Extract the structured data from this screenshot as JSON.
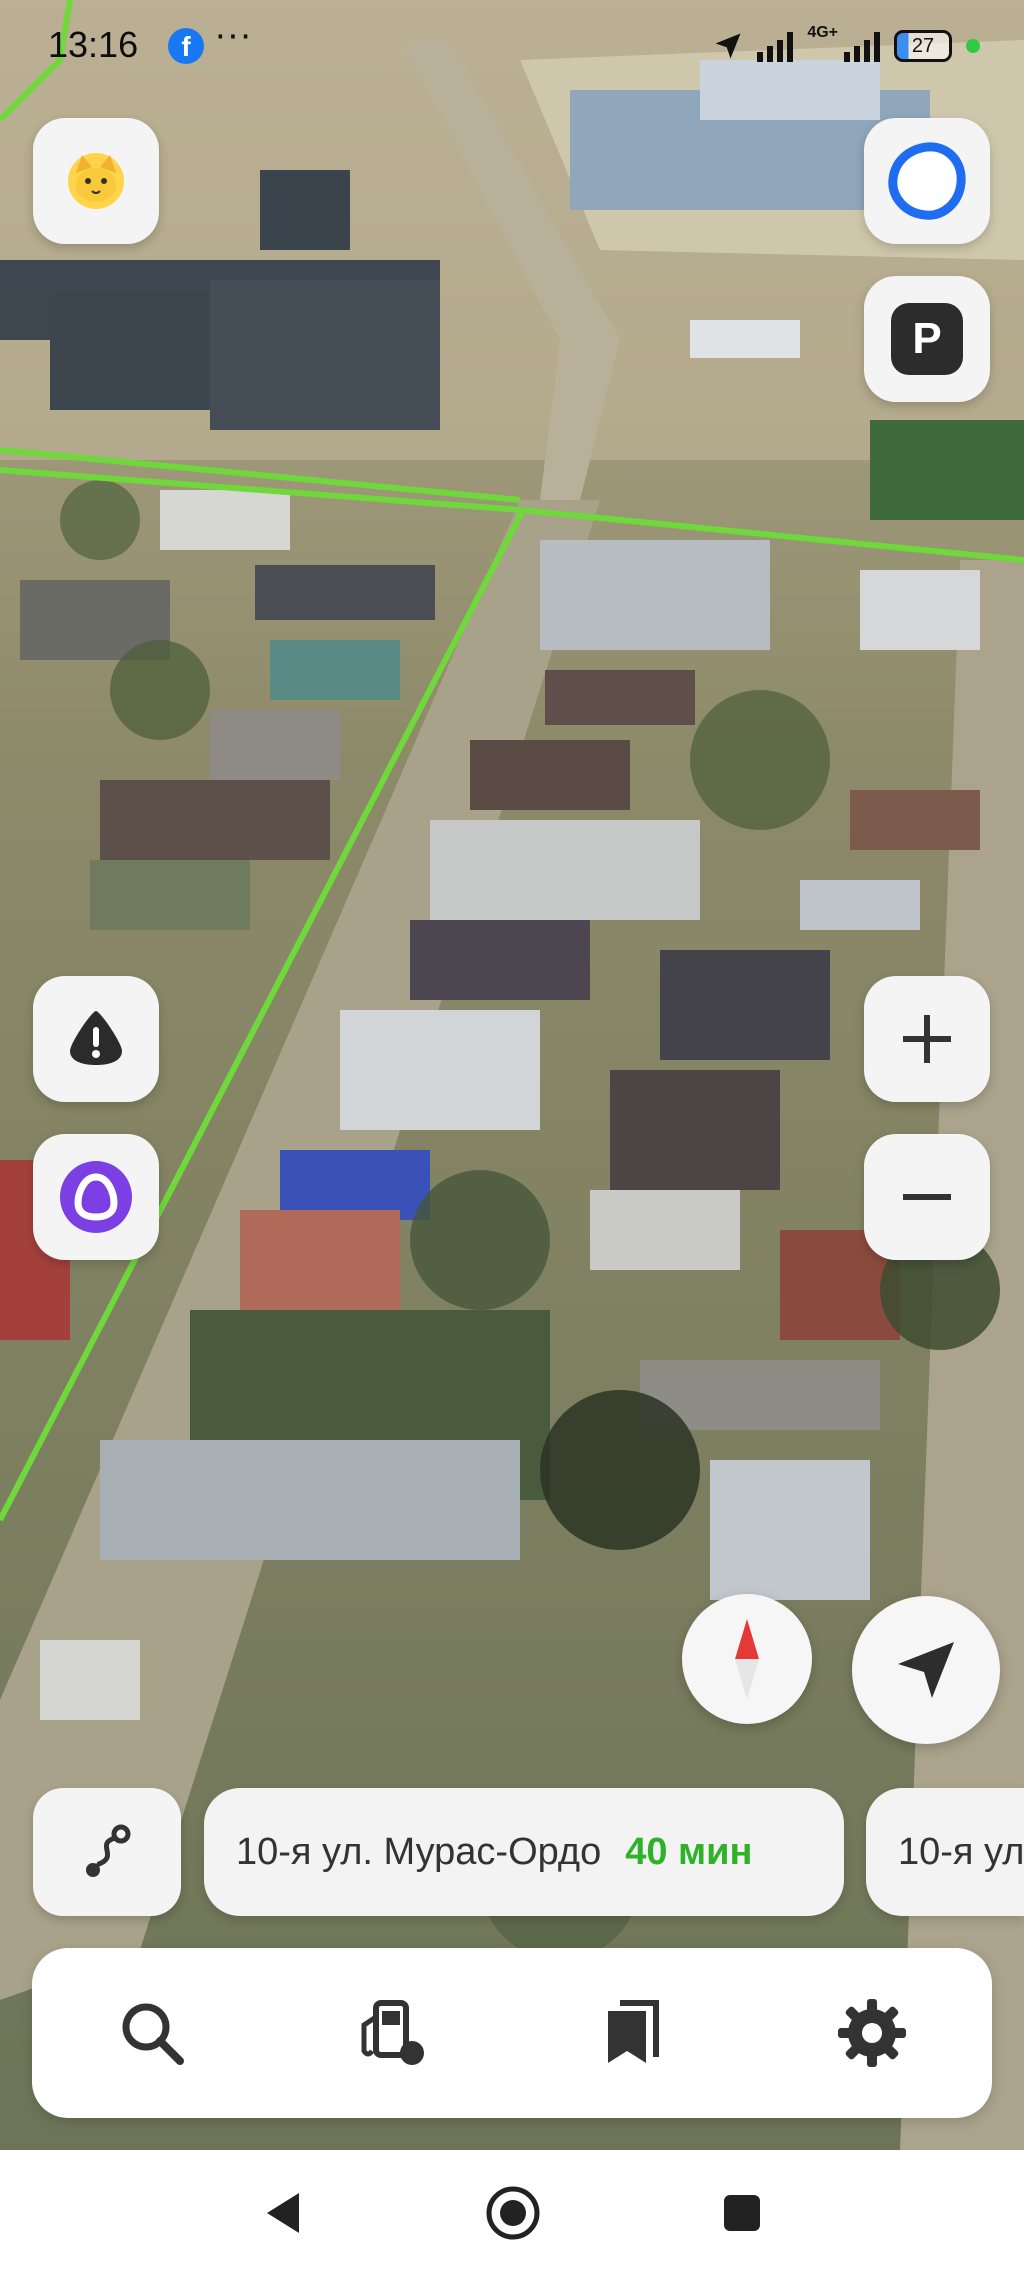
{
  "status_bar": {
    "time": "13:16",
    "facebook_badge": "f",
    "more": "···",
    "network": "4G+",
    "battery": "27"
  },
  "map": {
    "mode": "satellite",
    "route_line_color": "#6fd83a"
  },
  "route_chips": [
    {
      "destination": "10-я ул. Мурас-Ордо",
      "eta": "40 мин"
    },
    {
      "destination": "10-я ул"
    }
  ],
  "controls": {
    "left": [
      "cat-avatar-icon",
      "warning-icon",
      "alice-icon"
    ],
    "right": [
      "alice-ring-icon",
      "parking-icon",
      "zoom-in-icon",
      "zoom-out-icon"
    ],
    "compass": "compass-icon",
    "locate": "navigation-arrow-icon",
    "route": "route-icon",
    "parking_label": "P"
  },
  "bottom_bar": [
    "search-icon",
    "fuel-icon",
    "bookmarks-icon",
    "settings-icon"
  ],
  "nav_bar": [
    "back-icon",
    "home-icon",
    "recents-icon"
  ],
  "colors": {
    "accent_green": "#2fb12a",
    "alice_purple": "#7b3fe4",
    "alice_blue": "#1e6cf0",
    "compass_red": "#e53935"
  }
}
